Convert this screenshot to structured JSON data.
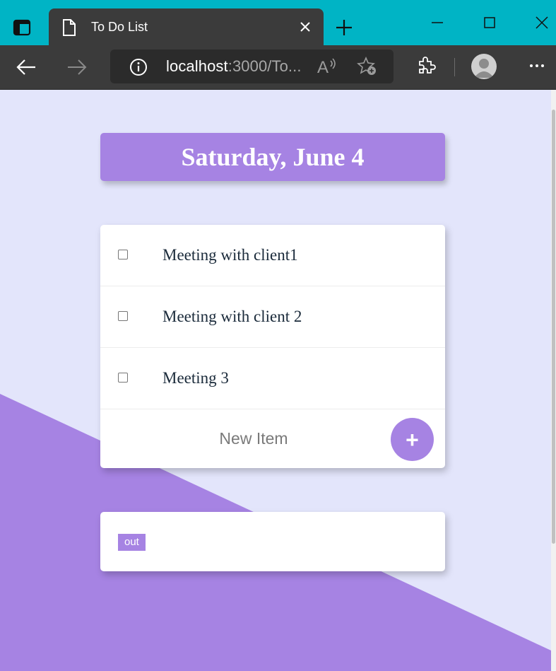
{
  "browser": {
    "tab_title": "To Do List",
    "address_host": "localhost",
    "address_path": ":3000/To...",
    "read_aloud_label": "A",
    "colors": {
      "titlebar": "#00b4c5",
      "toolbar": "#3b3b3b"
    },
    "icons": [
      "tab-actions-icon",
      "document-icon",
      "close-icon",
      "new-tab-icon",
      "minimize-icon",
      "maximize-icon",
      "window-close-icon",
      "back-arrow-icon",
      "forward-arrow-icon",
      "info-icon",
      "read-aloud-icon",
      "favorite-icon",
      "extensions-icon",
      "profile-icon",
      "more-icon"
    ]
  },
  "page": {
    "heading": "Saturday, June 4",
    "items": [
      {
        "text": "Meeting with client1",
        "checked": false
      },
      {
        "text": "Meeting with client 2",
        "checked": false
      },
      {
        "text": "Meeting 3",
        "checked": false
      }
    ],
    "new_item_placeholder": "New Item",
    "add_button_label": "+",
    "out_button_label": "out",
    "colors": {
      "accent": "#a683e3",
      "background": "#e3e5fb"
    }
  }
}
